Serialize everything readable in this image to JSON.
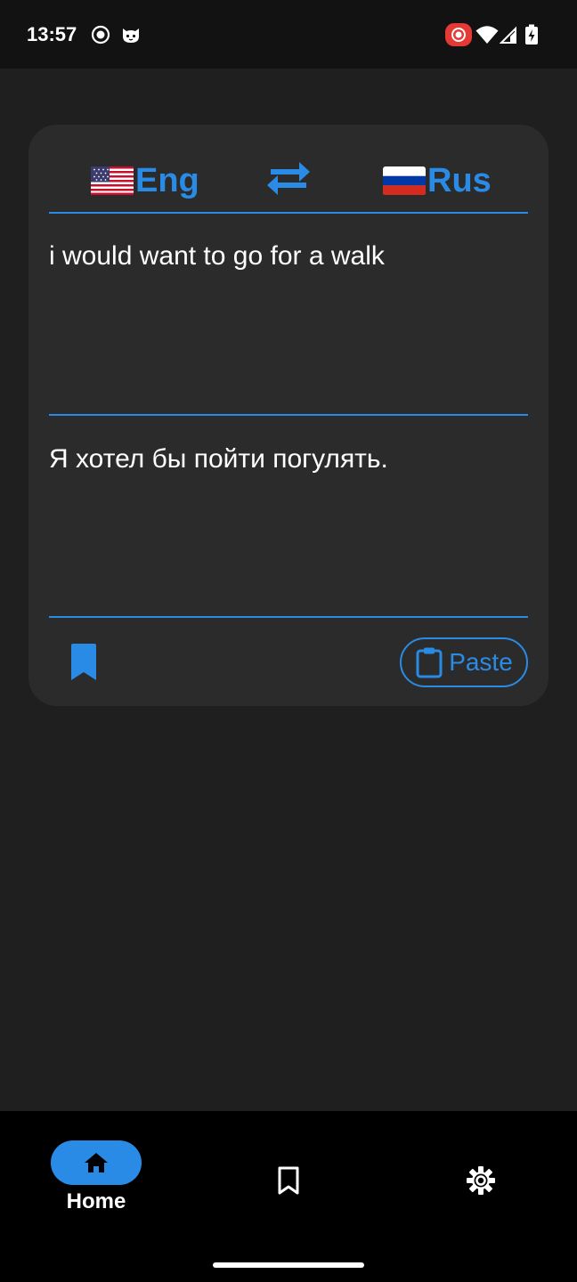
{
  "status_bar": {
    "time": "13:57",
    "left_icons": [
      "screen-record-icon",
      "cat-face-icon"
    ],
    "right_icons": [
      "cast-record-icon",
      "wifi-icon",
      "cell-signal-icon",
      "battery-charging-icon"
    ]
  },
  "translator": {
    "source_language": {
      "flag_icon": "us-flag-icon",
      "label": "Eng"
    },
    "target_language": {
      "flag_icon": "russia-flag-icon",
      "label": "Rus"
    },
    "swap_icon": "swap-arrows-icon",
    "source_text": "i would want to go for a walk",
    "translated_text": "Я хотел бы пойти погулять.",
    "bookmark_icon": "bookmark-filled-icon",
    "paste_label": "Paste",
    "paste_icon": "clipboard-icon"
  },
  "bottom_nav": {
    "items": [
      {
        "label": "Home",
        "icon": "home-icon",
        "active": true
      },
      {
        "label": "",
        "icon": "bookmark-outline-icon",
        "active": false
      },
      {
        "label": "",
        "icon": "settings-gear-icon",
        "active": false
      }
    ]
  },
  "colors": {
    "accent": "#2a8be6",
    "background": "#1f1f1f",
    "card": "#2b2b2b",
    "nav_background": "#000000",
    "status_bar": "#121212"
  }
}
